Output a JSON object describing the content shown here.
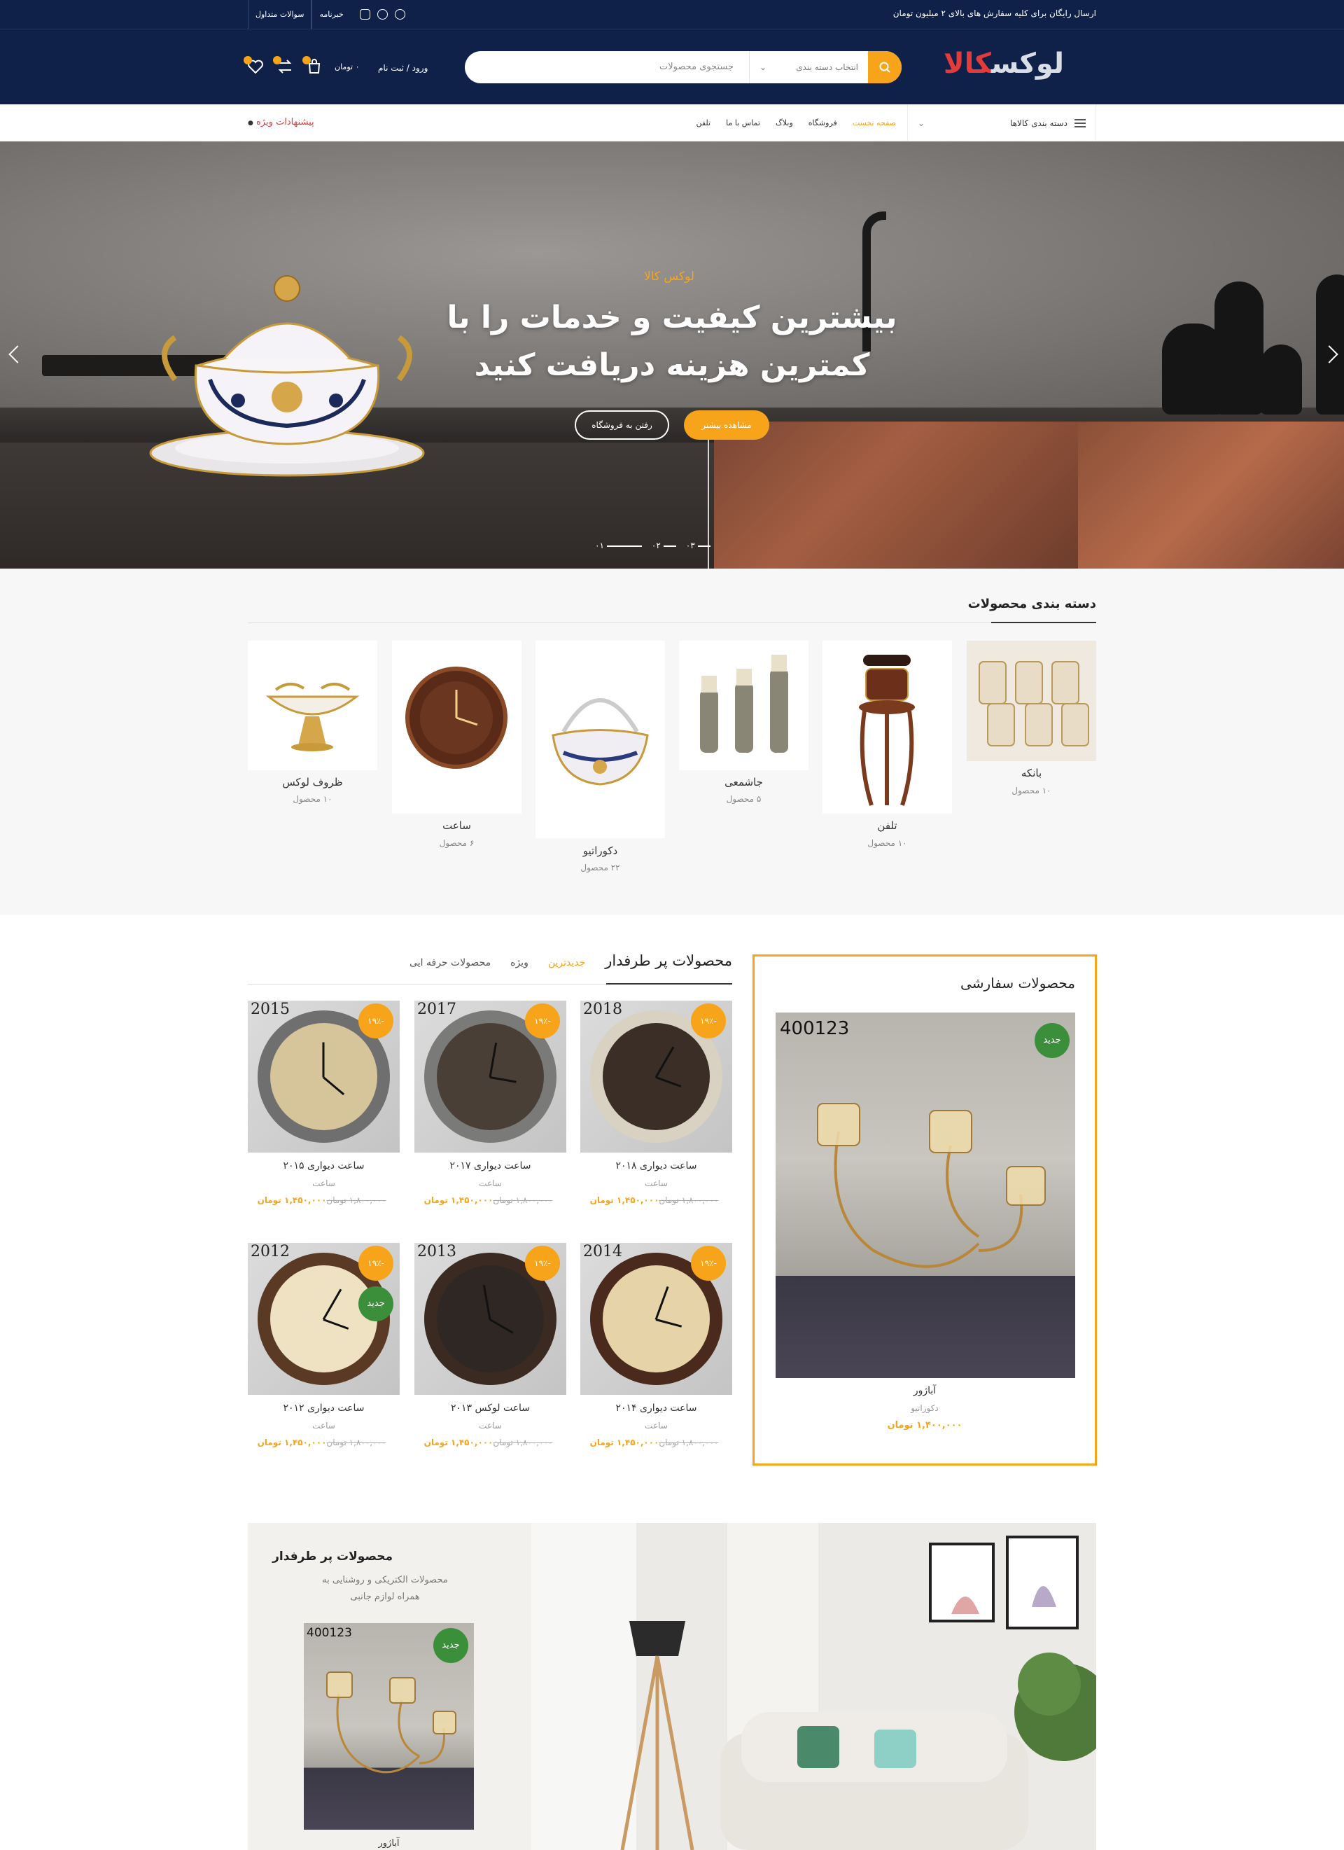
{
  "topbar": {
    "shipping_note": "ارسال رایگان برای کلیه سفارش های بالای ۲ میلیون تومان",
    "links": [
      "خبرنامه",
      "سوالات متداول"
    ]
  },
  "header": {
    "logo_part1": "لوکس",
    "logo_part2": "کالا",
    "search_placeholder": "جستجوی محصولات",
    "category_select": "انتخاب دسته بندی",
    "login_label": "ورود / ثبت نام",
    "cart_amount": "۰ تومان"
  },
  "nav": {
    "categories_label": "دسته بندی کالاها",
    "items": [
      {
        "label": "صفحه نخست",
        "active": true
      },
      {
        "label": "فروشگاه",
        "active": false
      },
      {
        "label": "وبلاگ",
        "active": false
      },
      {
        "label": "تماس با ما",
        "active": false
      },
      {
        "label": "تلفن",
        "active": false
      }
    ],
    "special_offers": "پیشنهادات ویژه"
  },
  "hero": {
    "eyebrow": "لوکس کالا",
    "headline_line1": "بیشترین کیفیت و خدمات را با",
    "headline_line2": "کمترین هزینه دریافت کنید",
    "primary_button": "مشاهده بیشتر",
    "secondary_button": "رفتن به فروشگاه",
    "slides": [
      "۰۱",
      "۰۲",
      "۰۳"
    ]
  },
  "categories": {
    "title": "دسته بندی محصولات",
    "items": [
      {
        "name": "بانکه",
        "count": "۱۰ محصول"
      },
      {
        "name": "تلفن",
        "count": "۱۰ محصول"
      },
      {
        "name": "جاشمعی",
        "count": "۵ محصول"
      },
      {
        "name": "دکوراتیو",
        "count": "۲۲ محصول"
      },
      {
        "name": "ساعت",
        "count": "۶ محصول"
      },
      {
        "name": "ظروف لوکس",
        "count": "۱۰ محصول"
      }
    ]
  },
  "featured": {
    "title": "محصولات سفارشی",
    "badge": "جدید",
    "image_code": "400123",
    "name": "آباژور",
    "category": "دکوراتیو",
    "price": "۱,۴۰۰,۰۰۰ تومان"
  },
  "products": {
    "title": "محصولات پر طرفدار",
    "tabs": [
      {
        "label": "جدیدترین",
        "active": true
      },
      {
        "label": "ویژه",
        "active": false
      },
      {
        "label": "محصولات حرفه ایی",
        "active": false
      }
    ],
    "discount_badge": "-۱۹٪",
    "new_badge": "جدید",
    "items": [
      {
        "name": "ساعت دیواری ۲۰۱۸",
        "category": "ساعت",
        "old_price": "۱,۸۰۰,۰۰۰ تومان",
        "new_price": "۱,۴۵۰,۰۰۰ تومان",
        "year": "2018"
      },
      {
        "name": "ساعت دیواری ۲۰۱۷",
        "category": "ساعت",
        "old_price": "۱,۸۰۰,۰۰۰ تومان",
        "new_price": "۱,۴۵۰,۰۰۰ تومان",
        "year": "2017"
      },
      {
        "name": "ساعت دیواری ۲۰۱۵",
        "category": "ساعت",
        "old_price": "۱,۸۰۰,۰۰۰ تومان",
        "new_price": "۱,۴۵۰,۰۰۰ تومان",
        "year": "2015"
      },
      {
        "name": "ساعت دیواری ۲۰۱۴",
        "category": "ساعت",
        "old_price": "۱,۸۰۰,۰۰۰ تومان",
        "new_price": "۱,۴۵۰,۰۰۰ تومان",
        "year": "2014"
      },
      {
        "name": "ساعت لوکس ۲۰۱۳",
        "category": "ساعت",
        "old_price": "۱,۸۰۰,۰۰۰ تومان",
        "new_price": "۱,۴۵۰,۰۰۰ تومان",
        "year": "2013"
      },
      {
        "name": "ساعت دیواری ۲۰۱۲",
        "category": "ساعت",
        "old_price": "۱,۸۰۰,۰۰۰ تومان",
        "new_price": "۱,۴۵۰,۰۰۰ تومان",
        "year": "2012"
      }
    ]
  },
  "banner": {
    "title": "محصولات پر طرفدار",
    "subtitle": "محصولات الکتریکی و روشنایی به همراه لوازم جانبی",
    "badge": "جدید",
    "image_code": "400123",
    "product_name": "آباژور"
  },
  "colors": {
    "navy": "#0f2148",
    "accent": "#f7a41a",
    "red": "#e43a3a",
    "green": "#3b8f3a"
  }
}
